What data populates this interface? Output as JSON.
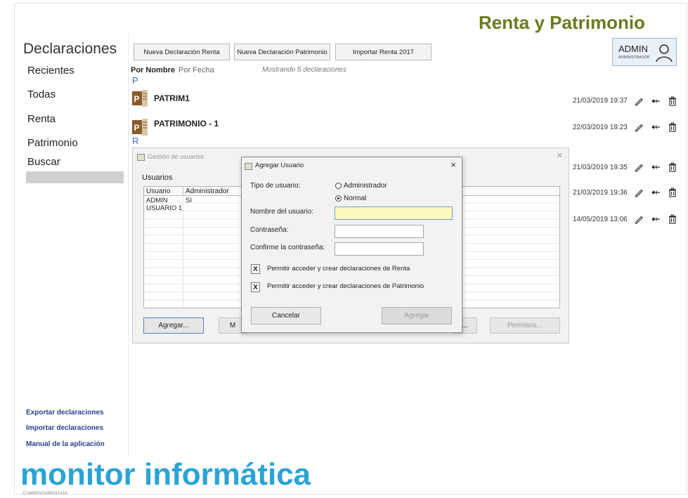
{
  "header": {
    "app_title": "Renta y Patrimonio"
  },
  "sidebar": {
    "title": "Declaraciones",
    "items": [
      "Recientes",
      "Todas",
      "Renta",
      "Patrimonio",
      "Buscar"
    ],
    "links": [
      "Exportar declaraciones",
      "Importar declaraciones",
      "Manual de la aplicación"
    ]
  },
  "toolbar": {
    "new_renta": "Nueva Declaración Renta",
    "new_patrimonio": "Nueva Declaración Patrimonio",
    "import_renta": "Importar Renta 2017"
  },
  "user": {
    "name": "ADMIN",
    "role": "ADMINISTRADOR"
  },
  "list": {
    "sort_by_name": "Por Nombre",
    "sort_by_date": "Por Fecha",
    "showing": "Mostrando   5 declaraciones",
    "group_p": "P",
    "group_r": "R",
    "doc_icon_letter": "P",
    "rows": [
      {
        "name": "PATRIM1",
        "date": "21/03/2019 19:37"
      },
      {
        "name": "PATRIMONIO - 1",
        "date": "22/03/2019 18:23"
      },
      {
        "name": "",
        "date": "21/03/2019 19:35"
      },
      {
        "name": "",
        "date": "21/03/2019 19:36"
      },
      {
        "name": "",
        "date": "14/05/2019 13:06"
      }
    ]
  },
  "gestion_dialog": {
    "title": "Gestión de usuarios",
    "users_label": "Usuarios",
    "columns": [
      "Usuario",
      "Administrador"
    ],
    "rows": [
      [
        "ADMIN",
        "SI"
      ],
      [
        "USUARIO 1",
        ""
      ]
    ],
    "btn_agregar": "Agregar...",
    "btn_m": "M",
    "btn_dots": "...",
    "btn_permisos": "Permisos..."
  },
  "agregar_dialog": {
    "title": "Agregar Usuario",
    "close": "×",
    "tipo_label": "Tipo de usuario:",
    "opt_admin": "Administrador",
    "opt_normal": "Normal",
    "selected": "Normal",
    "nombre_label": "Nombre del usuario:",
    "nombre_value": "",
    "pass_label": "Contraseña:",
    "confirm_label": "Confirme la contraseña:",
    "perm_renta": "Permitir acceder y crear declaraciones de Renta",
    "perm_patrimonio": "Permitir acceder y crear declaraciones de Patrimonio",
    "check_mark": "X",
    "btn_cancel": "Cancelar",
    "btn_add": "Agregar"
  },
  "footer": {
    "brand": "monitor informática",
    "path": "C:\\MIRENTA\\RENTA18"
  },
  "colors": {
    "accent": "#6b7a1e",
    "brand": "#2aa4d5",
    "link": "#2a3f8f",
    "focus_input": "#fbf8c0"
  }
}
